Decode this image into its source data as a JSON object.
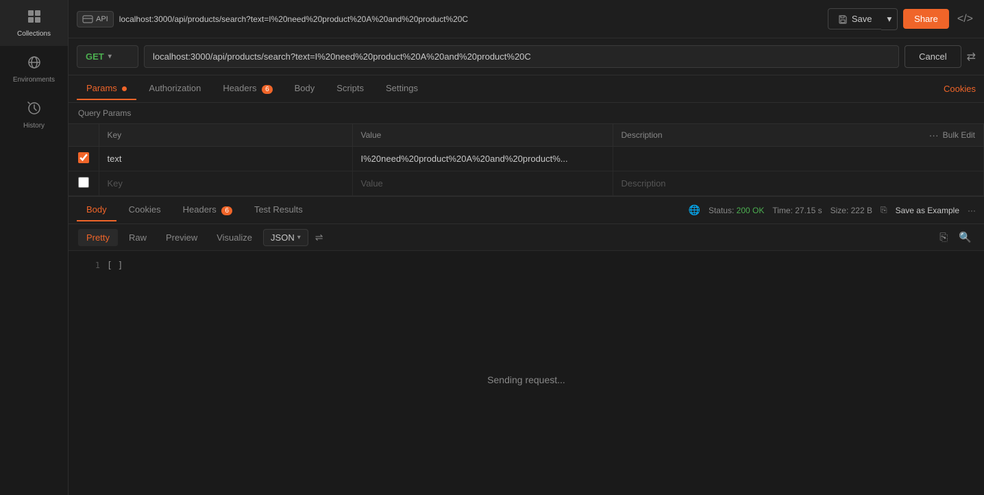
{
  "sidebar": {
    "items": [
      {
        "id": "collections",
        "label": "Collections",
        "icon": "⊞"
      },
      {
        "id": "environments",
        "label": "Environments",
        "icon": "⊙"
      },
      {
        "id": "history",
        "label": "History",
        "icon": "◷"
      },
      {
        "id": "more",
        "label": "",
        "icon": "⊞"
      }
    ]
  },
  "topbar": {
    "api_icon_text": "API",
    "url": "localhost:3000/api/products/search?text=I%20need%20product%20A%20and%20product%20C",
    "save_label": "Save",
    "share_label": "Share",
    "code_icon": "</>",
    "transfer_icon": "⇄"
  },
  "request_bar": {
    "method": "GET",
    "url": "localhost:3000/api/products/search?text=I%20need%20product%20A%20and%20product%20C",
    "cancel_label": "Cancel"
  },
  "tabs": {
    "items": [
      {
        "id": "params",
        "label": "Params",
        "active": true,
        "dot": true
      },
      {
        "id": "authorization",
        "label": "Authorization",
        "active": false
      },
      {
        "id": "headers",
        "label": "Headers",
        "badge": "6",
        "active": false
      },
      {
        "id": "body",
        "label": "Body",
        "active": false
      },
      {
        "id": "scripts",
        "label": "Scripts",
        "active": false
      },
      {
        "id": "settings",
        "label": "Settings",
        "active": false
      }
    ],
    "cookies_label": "Cookies"
  },
  "query_params": {
    "section_label": "Query Params",
    "columns": {
      "key": "Key",
      "value": "Value",
      "description": "Description",
      "bulk_edit": "Bulk Edit"
    },
    "rows": [
      {
        "checked": true,
        "key": "text",
        "value": "I%20need%20product%20A%20and%20product%...",
        "description": ""
      },
      {
        "checked": false,
        "key": "Key",
        "value": "Value",
        "description": "Description"
      }
    ]
  },
  "response": {
    "tabs": [
      {
        "id": "body",
        "label": "Body",
        "active": true
      },
      {
        "id": "cookies",
        "label": "Cookies",
        "active": false
      },
      {
        "id": "headers",
        "label": "Headers",
        "badge": "6",
        "active": false
      },
      {
        "id": "test_results",
        "label": "Test Results",
        "active": false
      }
    ],
    "status": {
      "icon": "🌐",
      "text": "Status:",
      "code": "200",
      "ok": "OK",
      "time_label": "Time:",
      "time": "27.15 s",
      "size_label": "Size:",
      "size": "222 B"
    },
    "save_example_label": "Save as Example",
    "format_tabs": [
      {
        "id": "pretty",
        "label": "Pretty",
        "active": true
      },
      {
        "id": "raw",
        "label": "Raw",
        "active": false
      },
      {
        "id": "preview",
        "label": "Preview",
        "active": false
      },
      {
        "id": "visualize",
        "label": "Visualize",
        "active": false
      }
    ],
    "format_select": "JSON",
    "sending_message": "Sending request...",
    "line1": "1",
    "bracket": "[ ]"
  }
}
